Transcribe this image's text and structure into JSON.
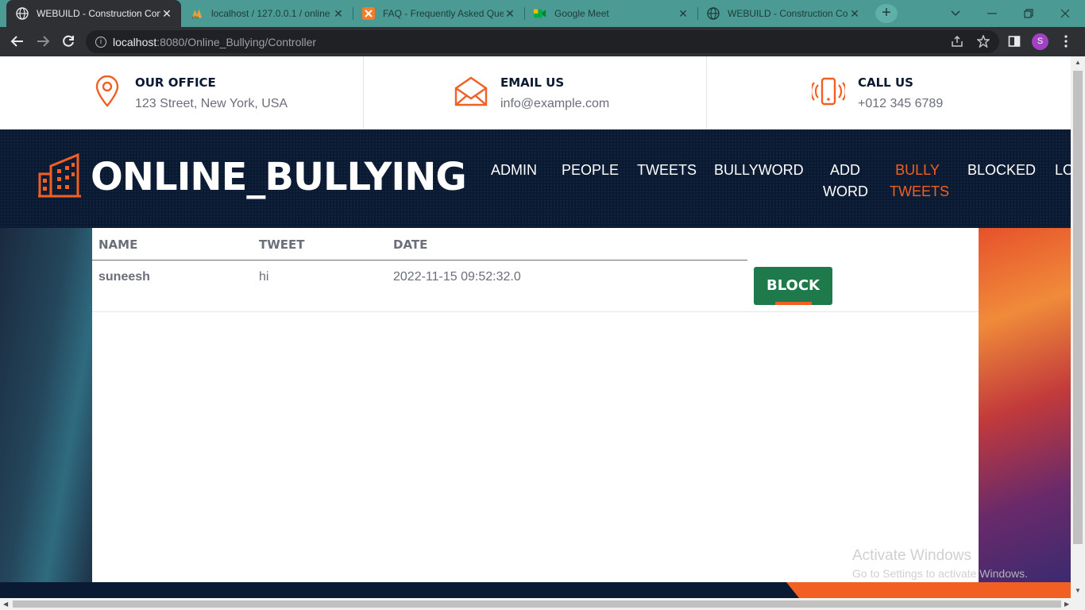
{
  "browser": {
    "tabs": [
      {
        "title": "WEBUILD - Construction Con",
        "icon": "globe-icon",
        "active": true
      },
      {
        "title": "localhost / 127.0.0.1 / online",
        "icon": "phpmyadmin-icon",
        "active": false
      },
      {
        "title": "FAQ - Frequently Asked Que",
        "icon": "xampp-icon",
        "active": false
      },
      {
        "title": "Google Meet",
        "icon": "google-meet-icon",
        "active": false
      },
      {
        "title": "WEBUILD - Construction Con",
        "icon": "globe-icon",
        "active": false
      }
    ],
    "close_glyph": "✕",
    "new_tab_glyph": "+",
    "url_host": "localhost",
    "url_rest": ":8080/Online_Bullying/Controller",
    "profile_initial": "S"
  },
  "topinfo": {
    "office": {
      "title": "OUR OFFICE",
      "value": "123 Street, New York, USA",
      "icon": "location-pin-icon"
    },
    "email": {
      "title": "EMAIL US",
      "value": "info@example.com",
      "icon": "envelope-icon"
    },
    "call": {
      "title": "CALL US",
      "value": "+012 345 6789",
      "icon": "phone-vibrate-icon"
    }
  },
  "brand": {
    "name": "ONLINE_BULLYING",
    "icon": "buildings-icon"
  },
  "nav": {
    "admin": "ADMIN",
    "people": "PEOPLE",
    "tweets": "TWEETS",
    "bullyword": "BULLYWORD",
    "add_word_1": "ADD",
    "add_word_2": "WORD",
    "bully_tweets_1": "BULLY",
    "bully_tweets_2": "TWEETS",
    "blocked": "BLOCKED",
    "logout_partial": "LO"
  },
  "table": {
    "headers": {
      "name": "NAME",
      "tweet": "TWEET",
      "date": "DATE"
    },
    "rows": [
      {
        "name": "suneesh",
        "tweet": "hi",
        "date": "2022-11-15 09:52:32.0",
        "action": "BLOCK"
      }
    ]
  },
  "watermark": {
    "line1": "Activate Windows",
    "line2": "Go to Settings to activate Windows."
  },
  "colors": {
    "accent": "#f15f22",
    "navy": "#0b1a33",
    "button_green": "#1e7a4a",
    "tabbar": "#4b9b94"
  }
}
